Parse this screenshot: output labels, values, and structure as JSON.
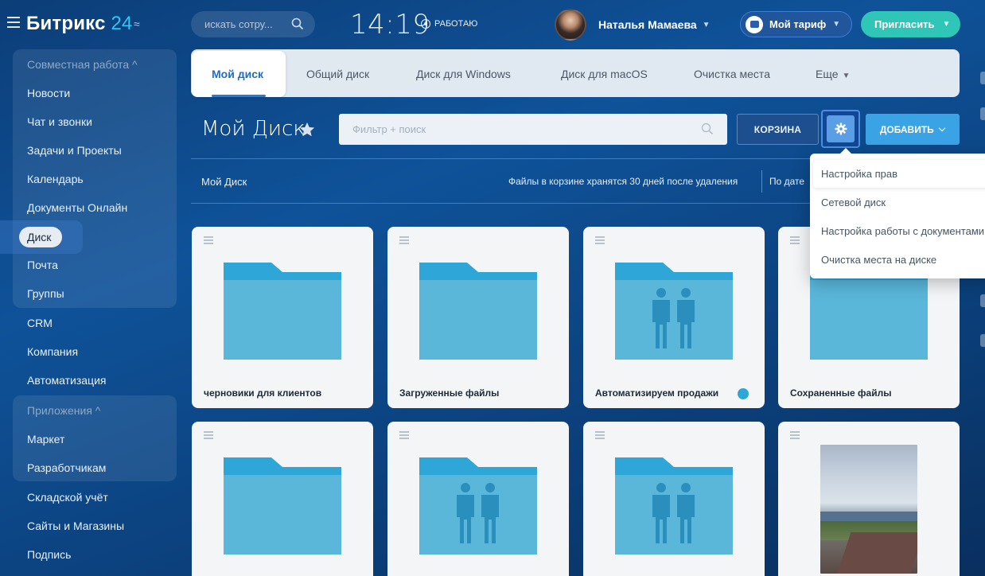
{
  "header": {
    "logo_text": "Битрикс",
    "logo_num": "24",
    "search_placeholder": "искать сотру...",
    "clock": "14:19",
    "status": "РАБОТАЮ",
    "user_name": "Наталья Мамаева",
    "tariff": "Мой тариф",
    "invite": "Пригласить"
  },
  "sidebar": {
    "items": [
      {
        "label": "Совместная работа ^",
        "muted": true
      },
      {
        "label": "Новости"
      },
      {
        "label": "Чат и звонки"
      },
      {
        "label": "Задачи и Проекты"
      },
      {
        "label": "Календарь"
      },
      {
        "label": "Документы Онлайн"
      },
      {
        "label": "Диск",
        "active": true
      },
      {
        "label": "Почта"
      },
      {
        "label": "Группы"
      },
      {
        "label": "CRM"
      },
      {
        "label": "Компания"
      },
      {
        "label": "Автоматизация"
      },
      {
        "label": "Приложения ^",
        "muted": true
      },
      {
        "label": "Маркет"
      },
      {
        "label": "Разработчикам"
      },
      {
        "label": "Складской учёт"
      },
      {
        "label": "Сайты и Магазины"
      },
      {
        "label": "Подпись"
      }
    ]
  },
  "tabs": [
    {
      "label": "Мой диск",
      "active": true
    },
    {
      "label": "Общий диск"
    },
    {
      "label": "Диск для Windows"
    },
    {
      "label": "Диск для macOS"
    },
    {
      "label": "Очистка места"
    },
    {
      "label": "Еще"
    }
  ],
  "toolbar": {
    "title": "Мой Диск",
    "filter_placeholder": "Фильтр + поиск",
    "trash_label": "КОРЗИНА",
    "add_label": "ДОБАВИТЬ"
  },
  "infobar": {
    "breadcrumb": "Мой Диск",
    "trash_note": "Файлы в корзине хранятся 30 дней после удаления",
    "sort_label": "По дате"
  },
  "settings_menu": {
    "items": [
      "Настройка прав",
      "Сетевой диск",
      "Настройка работы с документами",
      "Очистка места на диске"
    ]
  },
  "cards": [
    {
      "name": "черновики для клиентов",
      "type": "folder"
    },
    {
      "name": "Загруженные файлы",
      "type": "folder"
    },
    {
      "name": "Автоматизируем продажи",
      "type": "shared-folder",
      "shared_badge": true
    },
    {
      "name": "Сохраненные файлы",
      "type": "folder"
    },
    {
      "name": "",
      "type": "folder"
    },
    {
      "name": "",
      "type": "shared-folder"
    },
    {
      "name": "",
      "type": "shared-folder"
    },
    {
      "name": "",
      "type": "image"
    }
  ],
  "colors": {
    "accent": "#2a7ad3",
    "invite": "#2fc6b8",
    "folder_tab": "#2fa6d8",
    "folder_body": "#5ab7da"
  }
}
